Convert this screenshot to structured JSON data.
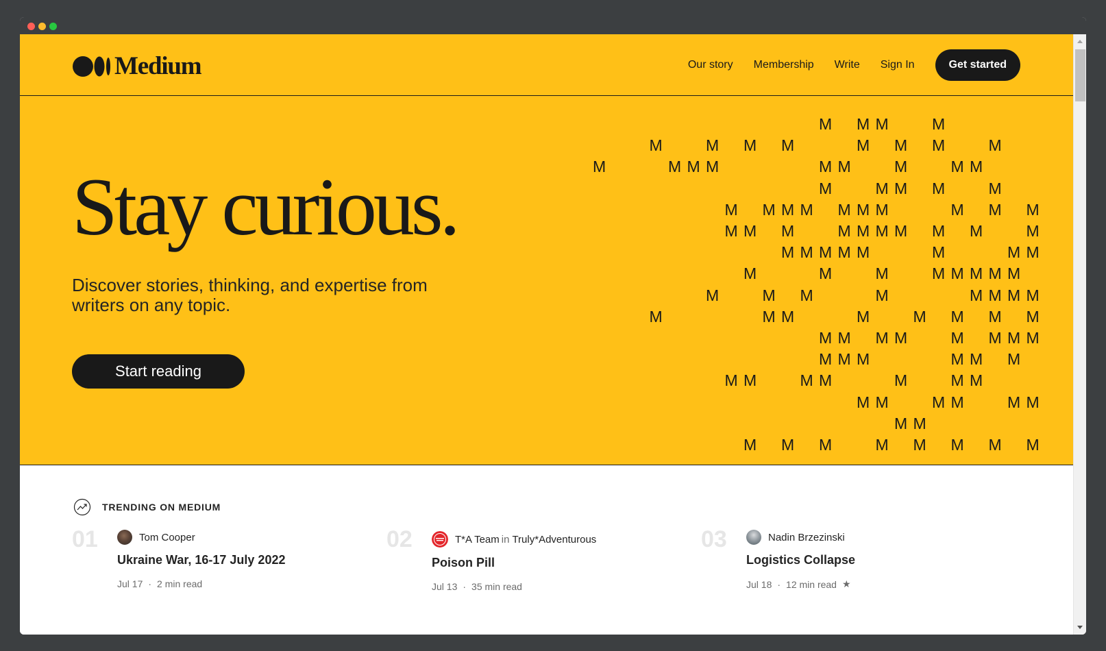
{
  "header": {
    "logo_text": "Medium",
    "nav": [
      "Our story",
      "Membership",
      "Write",
      "Sign In"
    ],
    "cta": "Get started"
  },
  "hero": {
    "title": "Stay curious.",
    "subtitle": "Discover stories, thinking, and expertise from writers on any topic.",
    "button": "Start reading",
    "art_glyph": "M"
  },
  "trending": {
    "label": "TRENDING ON MEDIUM",
    "items": [
      {
        "rank": "01",
        "author": "Tom Cooper",
        "publication": "",
        "title": "Ukraine War, 16-17 July 2022",
        "date": "Jul 17",
        "read": "2 min read",
        "member_only": false,
        "avatar_icon": "portrait-avatar"
      },
      {
        "rank": "02",
        "author": "T*A Team",
        "in_word": "in",
        "publication": "Truly*Adventurous",
        "title": "Poison Pill",
        "date": "Jul 13",
        "read": "35 min read",
        "member_only": false,
        "avatar_icon": "red-badge-avatar"
      },
      {
        "rank": "03",
        "author": "Nadin Brzezinski",
        "publication": "",
        "title": "Logistics Collapse",
        "date": "Jul 18",
        "read": "12 min read",
        "member_only": true,
        "star_glyph": "★",
        "avatar_icon": "portrait-avatar"
      }
    ]
  },
  "meta_separator": "·",
  "colors": {
    "brand_yellow": "#ffc017",
    "ink": "#191919",
    "muted": "#6b6b6b"
  }
}
